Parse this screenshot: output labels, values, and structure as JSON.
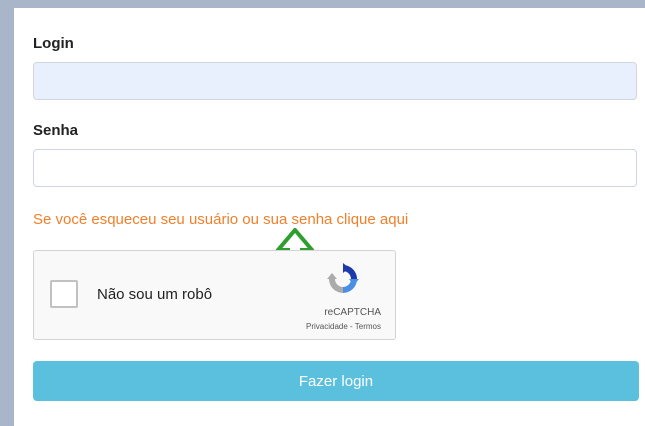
{
  "form": {
    "login_label": "Login",
    "login_value": "",
    "senha_label": "Senha",
    "senha_value": "",
    "forgot_link": "Se você esqueceu seu usuário ou sua senha clique aqui",
    "submit_label": "Fazer login"
  },
  "captcha": {
    "checkbox_label": "Não sou um robô",
    "brand": "reCAPTCHA",
    "privacy": "Privacidade",
    "separator": " - ",
    "terms": "Termos",
    "checked": false
  },
  "annotation": {
    "icon": "up-arrow-icon",
    "color": "#2e9e2e"
  },
  "colors": {
    "link": "#f0802c",
    "button": "#5bc0de",
    "filled_field": "#e8f0fe"
  }
}
